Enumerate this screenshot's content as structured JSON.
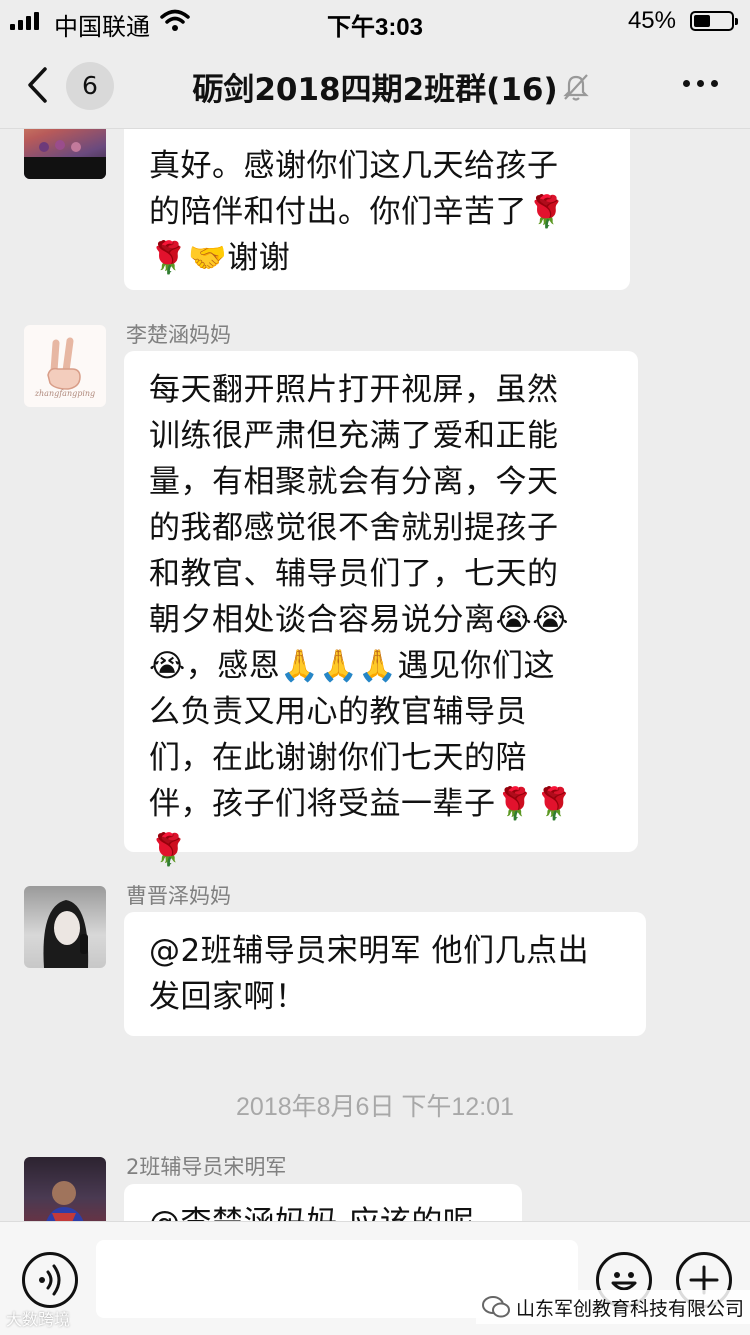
{
  "status_bar": {
    "carrier": "中国联通",
    "time": "下午3:03",
    "battery_percent": "45%",
    "battery_level": 0.45
  },
  "header": {
    "unread_count": "6",
    "title": "砺剑2018四期2班群(16)"
  },
  "messages": [
    {
      "sender": "",
      "lines": [
        "真好。感谢你们这几天给孩子",
        "的陪伴和付出。你们辛苦了🌹",
        "🌹🤝谢谢"
      ]
    },
    {
      "sender": "李楚涵妈妈",
      "lines": [
        "每天翻开照片打开视屏，虽然",
        "训练很严肃但充满了爱和正能",
        "量，有相聚就会有分离，今天",
        "的我都感觉很不舍就别提孩子",
        "和教官、辅导员们了，七天的",
        "朝夕相处谈合容易说分离😭😭",
        "😭，感恩🙏🙏🙏遇见你们这",
        "么负责又用心的教官辅导员",
        "们，在此谢谢你们七天的陪",
        "伴，孩子们将受益一辈子🌹🌹",
        "🌹"
      ]
    },
    {
      "sender": "曹晋泽妈妈",
      "lines": [
        "@2班辅导员宋明军 他们几点出",
        "发回家啊！"
      ]
    },
    {
      "timestamp": "2018年8月6日 下午12:01"
    },
    {
      "sender": "2班辅导员宋明军",
      "lines": [
        "@李楚涵妈妈 应该的呢"
      ]
    }
  ],
  "avatar_caption": "zhangfangping",
  "watermarks": {
    "left": "大数跨境",
    "right": "山东军创教育科技有限公司"
  },
  "icons": {
    "back": "chevron-left-icon",
    "mute": "bell-off-icon",
    "more": "more-dots-icon",
    "voice": "voice-icon",
    "emoji": "smiley-icon",
    "plus": "plus-icon",
    "wechat": "wechat-icon"
  }
}
